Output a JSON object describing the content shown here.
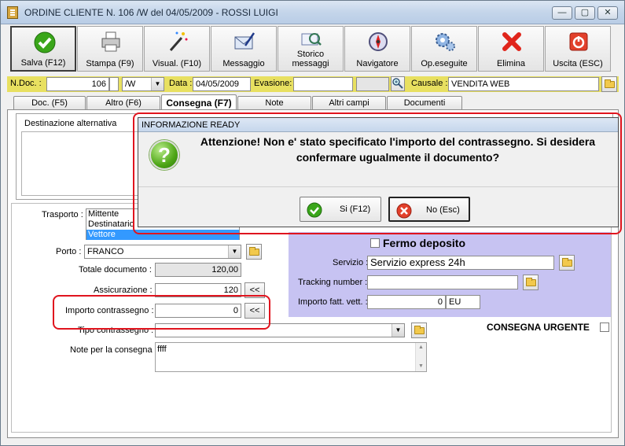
{
  "window": {
    "title": "ORDINE CLIENTE N. 106 /W del 04/05/2009 - ROSSI LUIGI",
    "controls": {
      "minimize": "—",
      "maximize": "▢",
      "close": "✕"
    }
  },
  "toolbar": {
    "items": [
      {
        "label": "Salva (F12)",
        "icon": "check-icon"
      },
      {
        "label": "Stampa (F9)",
        "icon": "printer-icon"
      },
      {
        "label": "Visual. (F10)",
        "icon": "magic-wand-icon"
      },
      {
        "label": "Messaggio",
        "icon": "envelope-icon"
      },
      {
        "label": "Storico messaggi",
        "icon": "search-mail-icon"
      },
      {
        "label": "Navigatore",
        "icon": "compass-icon"
      },
      {
        "label": "Op.eseguite",
        "icon": "gears-icon"
      },
      {
        "label": "Elimina",
        "icon": "delete-x-icon"
      },
      {
        "label": "Uscita (ESC)",
        "icon": "exit-icon"
      }
    ]
  },
  "header": {
    "ndoc_label": "N.Doc. :",
    "ndoc_value": "106",
    "series_value": "/W",
    "data_label": "Data :",
    "data_value": "04/05/2009",
    "evasione_label": "Evasione:",
    "evasione_value": "",
    "causale_label": "Causale :",
    "causale_value": "VENDITA WEB"
  },
  "tabs": [
    {
      "label": "Doc. (F5)"
    },
    {
      "label": "Altro (F6)"
    },
    {
      "label": "Consegna (F7)",
      "active": true
    },
    {
      "label": "Note"
    },
    {
      "label": "Altri campi"
    },
    {
      "label": "Documenti"
    }
  ],
  "consegna": {
    "dest_alt_label": "Destinazione alternativa",
    "trasporto_label": "Trasporto :",
    "trasporto_options": [
      "Mittente",
      "Destinatario",
      "Vettore"
    ],
    "trasporto_selected": "Vettore",
    "porto_label": "Porto :",
    "porto_value": "FRANCO",
    "totale_label": "Totale documento :",
    "totale_value": "120,00",
    "assicurazione_label": "Assicurazione :",
    "assicurazione_value": "120",
    "importo_label": "Importo contrassegno :",
    "importo_value": "0",
    "tipo_label": "Tipo contrassegno :",
    "tipo_value": "",
    "note_label": "Note per la consegna",
    "note_value": "ffff",
    "arrow_btn": "<<",
    "fermo_label": "Fermo deposito",
    "servizio_label": "Servizio :",
    "servizio_value": "Servizio express 24h",
    "tracking_label": "Tracking number :",
    "tracking_value": "",
    "importo_fatt_label": "Importo fatt. vett. :",
    "importo_fatt_value": "0",
    "currency_value": "EU",
    "urgente_label": "CONSEGNA URGENTE"
  },
  "dialog": {
    "title": "INFORMAZIONE READY",
    "message": "Attenzione! Non e' stato specificato l'importo del contrassegno. Si desidera confermare ugualmente il documento?",
    "yes_label": "Si (F12)",
    "no_label": "No (Esc)"
  }
}
